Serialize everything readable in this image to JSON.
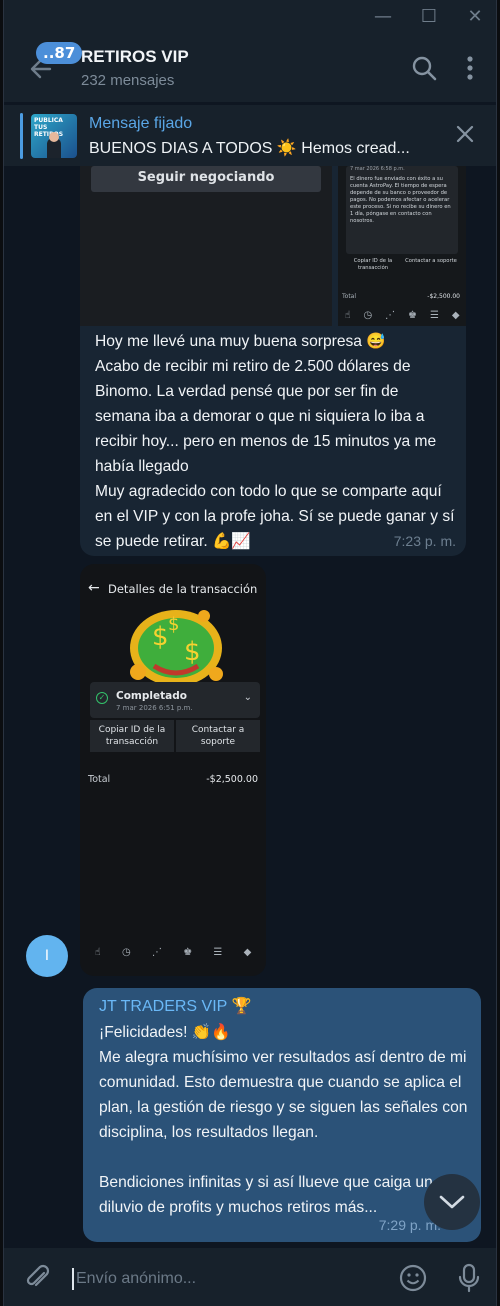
{
  "window": {
    "minimize": "—",
    "maximize": "☐",
    "close": "✕"
  },
  "header": {
    "unread_badge": "..87",
    "title": "RETIROS VIP",
    "subtitle": "232 mensajes"
  },
  "pinned": {
    "label": "Mensaje fijado",
    "text": "BUENOS DIAS A TODOS ☀️  Hemos cread...",
    "thumb_text": "PUBLICA TUS RETIROS"
  },
  "messages": {
    "first": {
      "photo_left_button": "Seguir negociando",
      "receipt_small": {
        "date": "7 mar 2026 6:58 p.m.",
        "body": "El dinero fue enviado con éxito a su cuenta AstroPay. El tiempo de espera depende de su banco o proveedor de pagos. No podemos afectar o acelerar este proceso. Si no recibe su dinero en 1 día, póngase en contacto con nosotros.",
        "copy_id": "Copiar ID de la transacción",
        "contact": "Contactar a soporte",
        "total_label": "Total",
        "total_value": "-$2,500.00"
      },
      "text": "Hoy me llevé una muy buena sorpresa 😅\nAcabo de recibir mi retiro de 2.500 dólares de Binomo. La verdad pensé que por ser fin de semana iba a demorar o que ni siquiera lo iba a recibir hoy... pero en menos de 15 minutos ya me había llegado\nMuy agradecido con todo lo que se comparte aquí en el VIP y con la profe joha. Sí se puede ganar y sí se puede retirar. 💪📈",
      "time": "7:23 p. m."
    },
    "second": {
      "screen_title": "Detalles de la transacción",
      "status": "Completado",
      "date": "7 mar 2026 6:51 p.m.",
      "copy_id": "Copiar ID de la transacción",
      "contact": "Contactar a soporte",
      "total_label": "Total",
      "total_value": "-$2,500.00",
      "avatar_letter": "I"
    },
    "reply": {
      "author": "JT TRADERS VIP 🏆",
      "text": "¡Felicidades! 👏🔥\nMe alegra muchísimo ver resultados así dentro de mi comunidad. Esto demuestra que cuando se aplica el plan, la gestión de riesgo y se siguen las señales con disciplina, los resultados llegan.\n\nBendiciones infinitas y si así llueve que caiga un diluvio de profits y muchos retiros más...",
      "time": "7:29 p. m."
    }
  },
  "composer": {
    "placeholder": "Envío anónimo..."
  },
  "colors": {
    "background": "#0e1621",
    "header": "#17212b",
    "incoming_bubble": "#182533",
    "outgoing_bubble": "#2b5278",
    "accent": "#5aa6e6"
  }
}
